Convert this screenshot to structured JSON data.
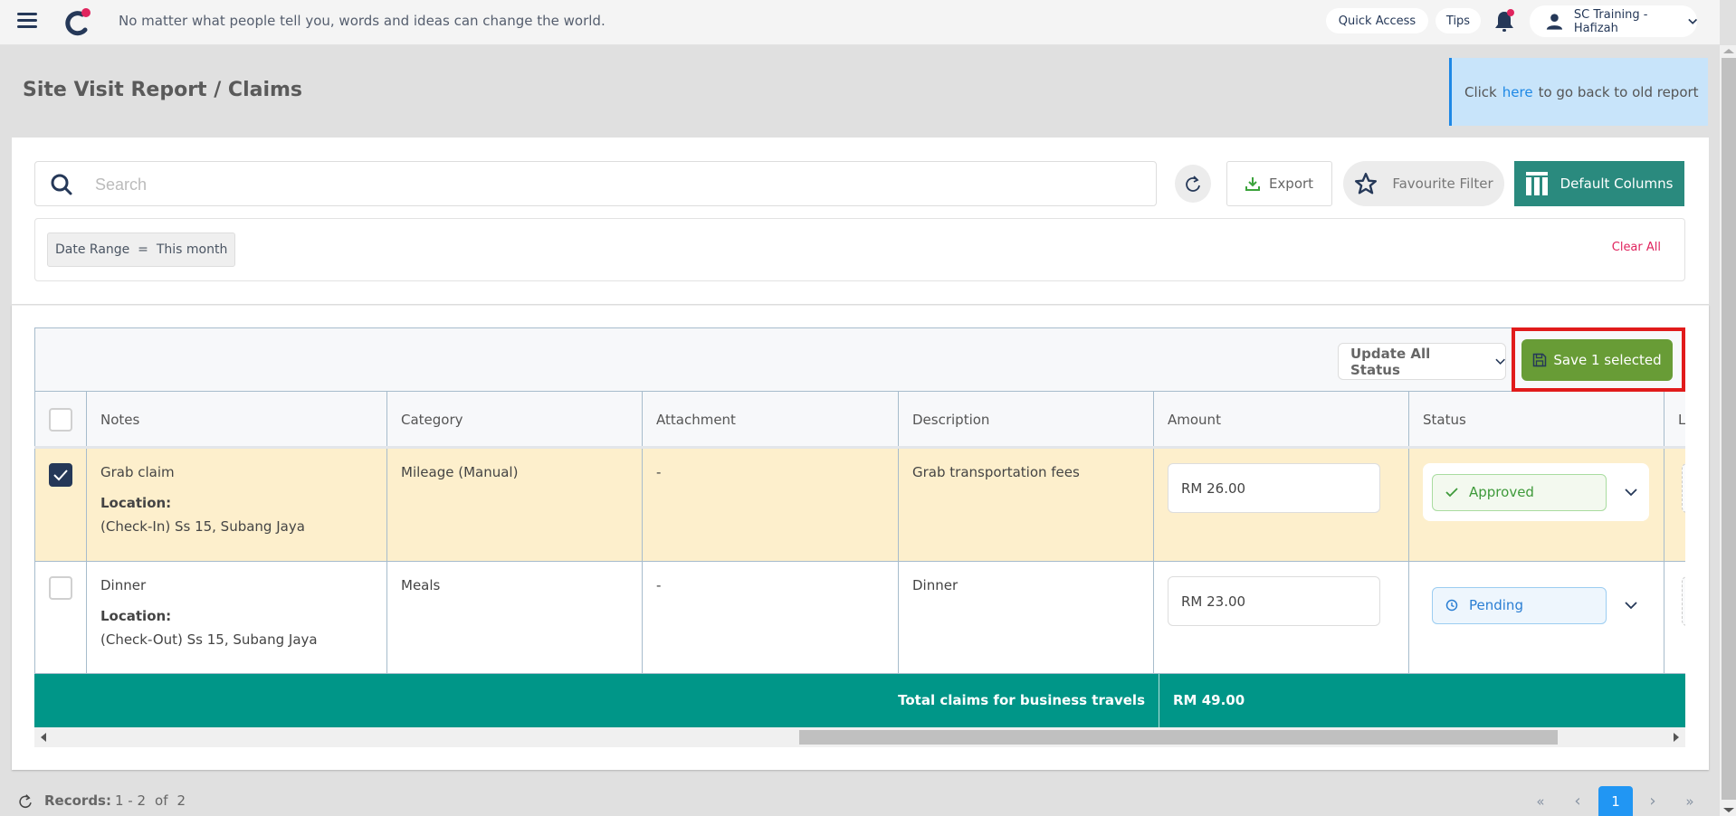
{
  "topbar": {
    "motto": "No matter what people tell you, words and ideas can change the world.",
    "quick_access": "Quick Access",
    "tips": "Tips",
    "user_name": "SC Training - Hafizah",
    "brand_color": "#253858",
    "accent_color": "#e0245e"
  },
  "page": {
    "title": "Site Visit Report / Claims",
    "old_report": {
      "prefix": "Click",
      "link": "here",
      "suffix": "to go back to old report"
    }
  },
  "toolbar": {
    "search_placeholder": "Search",
    "search_value": "",
    "export_label": "Export",
    "favourite_label": "Favourite Filter",
    "columns_label": "Default Columns"
  },
  "filters": {
    "chips": [
      {
        "label": "Date Range  =  This month"
      }
    ],
    "clear_all": "Clear All"
  },
  "table": {
    "update_all_status": "Update All Status",
    "save_selected": "Save 1 selected",
    "columns": [
      "Notes",
      "Category",
      "Attachment",
      "Description",
      "Amount",
      "Status",
      "L"
    ],
    "rows": [
      {
        "selected": true,
        "note": "Grab claim",
        "location_label": "Location:",
        "location": "(Check-In) Ss 15, Subang Jaya",
        "category": "Mileage (Manual)",
        "attachment": "-",
        "description": "Grab transportation fees",
        "amount": "RM 26.00",
        "status": "Approved"
      },
      {
        "selected": false,
        "note": "Dinner",
        "location_label": "Location:",
        "location": "(Check-Out) Ss 15, Subang Jaya",
        "category": "Meals",
        "attachment": "-",
        "description": "Dinner",
        "amount": "RM 23.00",
        "status": "Pending"
      }
    ],
    "total_label": "Total claims for business travels",
    "total_value": "RM 49.00"
  },
  "footer": {
    "records_label": "Records:",
    "records_range": "1 - 2",
    "records_of": "of",
    "records_total": "2",
    "pagination": {
      "first": "«",
      "prev": "‹",
      "current": "1",
      "next": "›",
      "last": "»"
    }
  }
}
